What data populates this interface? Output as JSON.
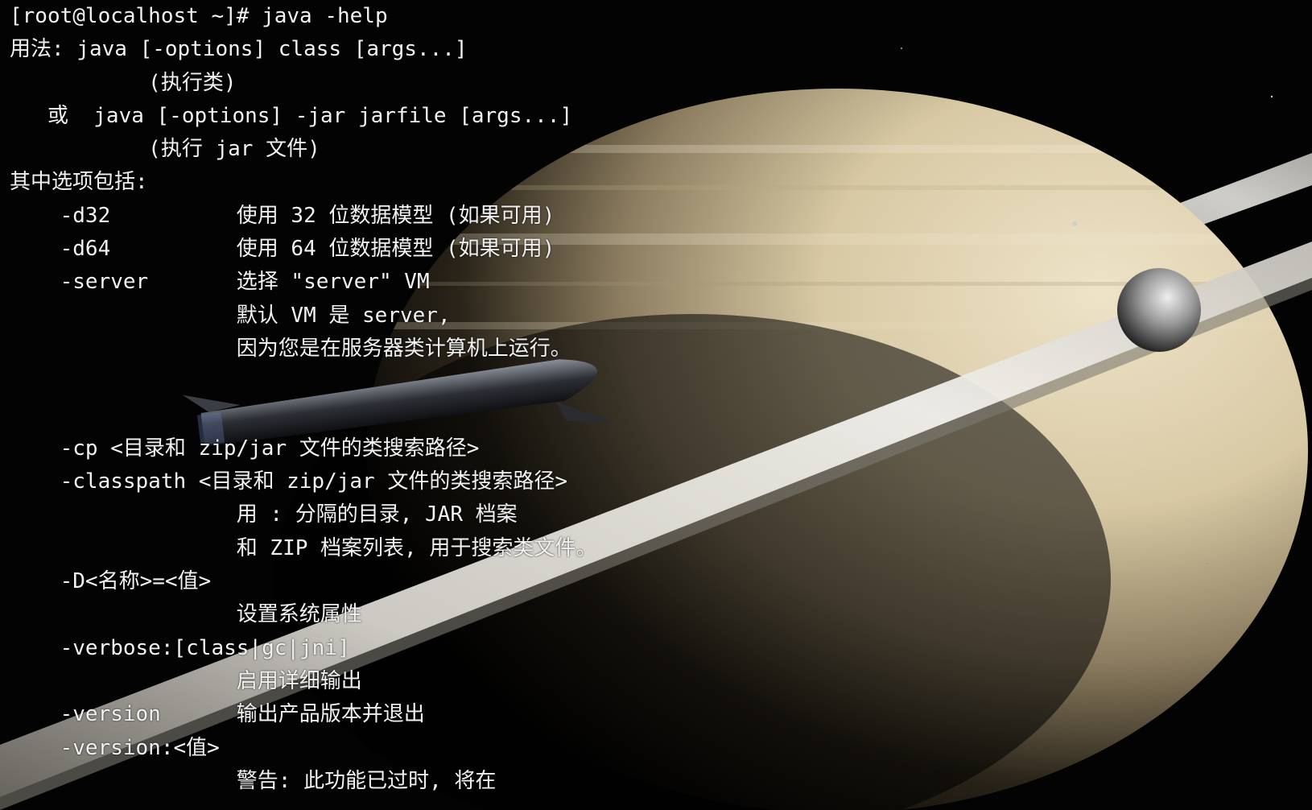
{
  "window": {
    "app": "terminal",
    "background": "saturn-starship-wallpaper"
  },
  "terminal": {
    "prompt": "[root@localhost ~]#",
    "command": "java -help",
    "lines": [
      "[root@localhost ~]# java -help",
      "用法: java [-options] class [args...]",
      "           (执行类)",
      "   或  java [-options] -jar jarfile [args...]",
      "           (执行 jar 文件)",
      "其中选项包括:",
      "    -d32          使用 32 位数据模型 (如果可用)",
      "    -d64          使用 64 位数据模型 (如果可用)",
      "    -server       选择 \"server\" VM",
      "                  默认 VM 是 server,",
      "                  因为您是在服务器类计算机上运行。",
      "",
      "",
      "    -cp <目录和 zip/jar 文件的类搜索路径>",
      "    -classpath <目录和 zip/jar 文件的类搜索路径>",
      "                  用 : 分隔的目录, JAR 档案",
      "                  和 ZIP 档案列表, 用于搜索类文件。",
      "    -D<名称>=<值>",
      "                  设置系统属性",
      "    -verbose:[class|gc|jni]",
      "                  启用详细输出",
      "    -version      输出产品版本并退出",
      "    -version:<值>",
      "                  警告: 此功能已过时, 将在"
    ]
  },
  "colors": {
    "background": "#030303",
    "text": "#f2f2f2",
    "planet": "#d9ccab",
    "ring": "#e6e3dc"
  }
}
